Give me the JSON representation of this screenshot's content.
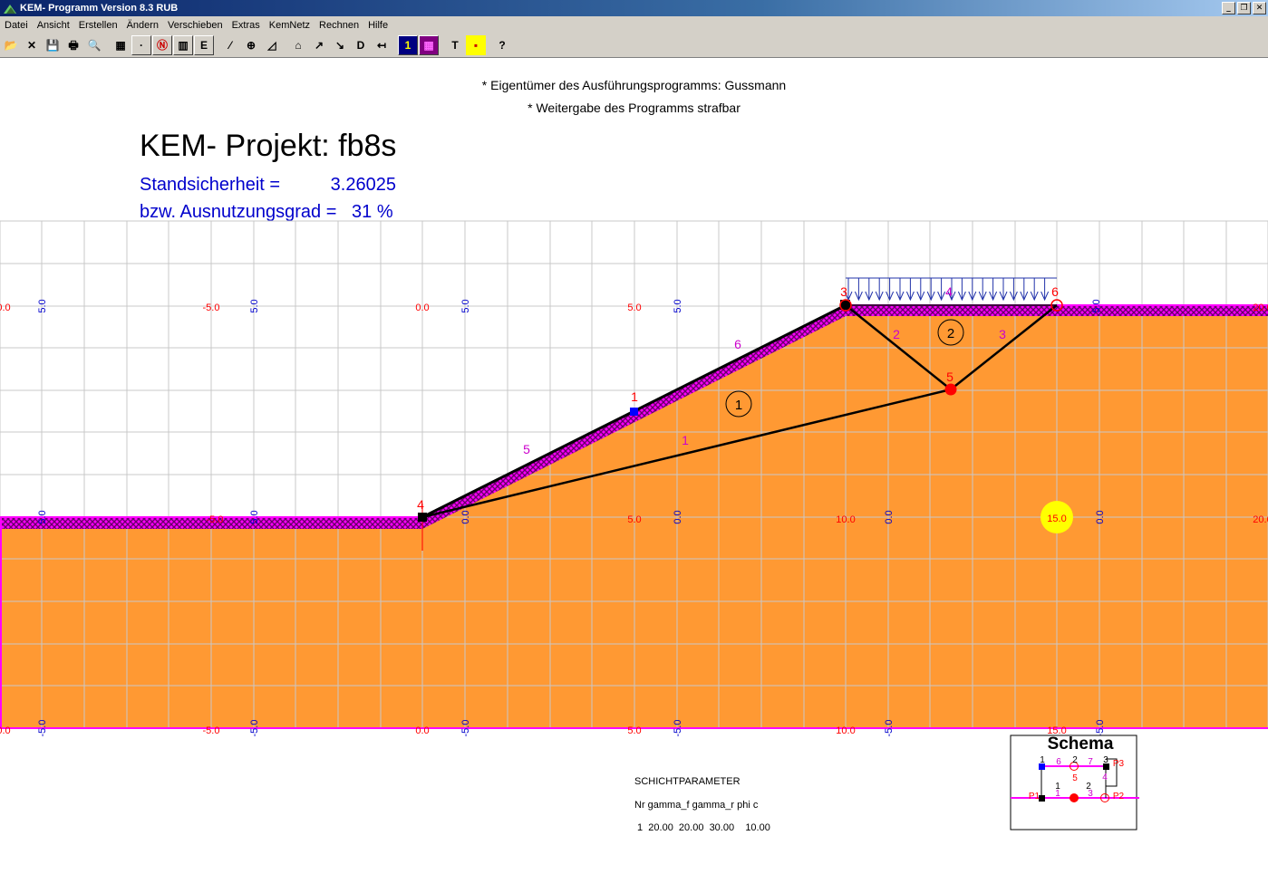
{
  "window": {
    "title": "KEM- Programm Version 8.3 RUB",
    "buttons": {
      "minimize": "_",
      "restore": "❐",
      "close": "✕"
    }
  },
  "menu": [
    "Datei",
    "Ansicht",
    "Erstellen",
    "Ändern",
    "Verschieben",
    "Extras",
    "KemNetz",
    "Rechnen",
    "Hilfe"
  ],
  "toolbar": [
    {
      "name": "open-icon",
      "glyph": "📂"
    },
    {
      "name": "close-file-icon",
      "glyph": "✕"
    },
    {
      "name": "save-icon",
      "glyph": "💾"
    },
    {
      "name": "print-icon",
      "glyph": "🖶"
    },
    {
      "name": "print-preview-icon",
      "glyph": "🔍"
    },
    {
      "name": "grid-icon",
      "glyph": "▦"
    },
    {
      "name": "node-icon",
      "glyph": "·"
    },
    {
      "name": "no-entry-icon",
      "glyph": "Ⓝ"
    },
    {
      "name": "layer-icon",
      "glyph": "▥"
    },
    {
      "name": "e-icon",
      "glyph": "E"
    },
    {
      "name": "line-icon",
      "glyph": "⁄"
    },
    {
      "name": "zoom-icon",
      "glyph": "⊕"
    },
    {
      "name": "slope-icon",
      "glyph": "◿"
    },
    {
      "name": "polygon-icon",
      "glyph": "⌂"
    },
    {
      "name": "arrow-icon",
      "glyph": "↗"
    },
    {
      "name": "arrow-down-icon",
      "glyph": "↘"
    },
    {
      "name": "d-icon",
      "glyph": "D"
    },
    {
      "name": "load-icon",
      "glyph": "↤"
    },
    {
      "name": "number-one-icon",
      "glyph": "1"
    },
    {
      "name": "matrix-icon",
      "glyph": "▦"
    },
    {
      "name": "text-icon",
      "glyph": "T"
    },
    {
      "name": "tiles-icon",
      "glyph": "▪"
    },
    {
      "name": "help-icon",
      "glyph": "?"
    }
  ],
  "notices": [
    "* Eigentümer des Ausführungsprogramms: Gussmann",
    "* Weitergabe des Programms strafbar"
  ],
  "project": {
    "title": "KEM- Projekt: fb8s",
    "safety_line": "Standsicherheit =          3.26025",
    "utilization_line": "bzw. Ausnutzungsgrad =   31 %"
  },
  "diagram": {
    "colors": {
      "soil": "#ff9933",
      "surface": "#ff00ff",
      "hatch": "#6a006a",
      "grid": "#c8c8c8",
      "red_label": "#ff0000",
      "blue_label": "#0000cc",
      "magenta_label": "#cc00cc",
      "load": "#2233aa",
      "slip_line": "#000000",
      "node_red": "#ff0000",
      "node_blue": "#0000ff",
      "marker": "#ffff00"
    },
    "axis_labels_red_top": [
      "0.0",
      "-5.0",
      "0.0",
      "5.0",
      "10.0",
      "20.0"
    ],
    "axis_labels_blue_top": [
      "5.0",
      "5.0",
      "5.0",
      "5.0"
    ],
    "axis_labels_red_mid": [
      "-5.0",
      "5.0",
      "10.0",
      "20.0"
    ],
    "axis_labels_blue_mid": [
      "5.0",
      "0.0",
      "5.0",
      "0.0",
      "0.0",
      "0.0"
    ],
    "axis_labels_red_bottom": [
      "0.0",
      "-5.0",
      "0.0",
      "5.0",
      "10.0",
      "15.0"
    ],
    "axis_labels_blue_bottom": [
      "-5.0",
      "-5.0",
      "-5.0",
      "-5.0",
      "-5.0",
      "-5.0"
    ],
    "node_labels": [
      "1",
      "2",
      "3",
      "4",
      "5",
      "6"
    ],
    "element_labels": [
      "1",
      "2",
      "3",
      "4",
      "5",
      "6"
    ],
    "body_labels": [
      "1",
      "2"
    ],
    "marker_label": "15.0"
  },
  "parameters": {
    "heading": "SCHICHTPARAMETER",
    "columns": "Nr gamma_f gamma_r phi c",
    "row": " 1  20.00  20.00  30.00    10.00"
  },
  "schema": {
    "title": "Schema",
    "labels": [
      "1",
      "2",
      "3",
      "6",
      "7",
      "4",
      "1",
      "2",
      "5",
      "1",
      "3",
      "P1",
      "P2",
      "P3"
    ]
  }
}
